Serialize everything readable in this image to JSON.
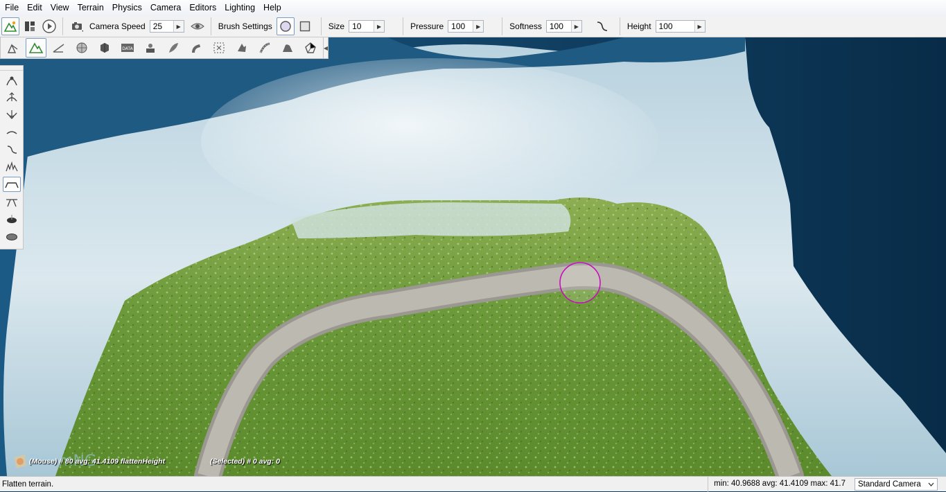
{
  "menu": [
    "File",
    "Edit",
    "View",
    "Terrain",
    "Physics",
    "Camera",
    "Editors",
    "Lighting",
    "Help"
  ],
  "toolbar": {
    "camera_speed_label": "Camera Speed",
    "camera_speed_value": "25",
    "brush_settings_label": "Brush Settings",
    "size_label": "Size",
    "size_value": "10",
    "pressure_label": "Pressure",
    "pressure_value": "100",
    "softness_label": "Softness",
    "softness_value": "100",
    "height_label": "Height",
    "height_value": "100"
  },
  "editor_tools": [
    "object-editor-icon",
    "terrain-editor-icon",
    "terrain-painter-icon",
    "sphere-icon",
    "cube-icon",
    "datablock-icon",
    "shape-icon",
    "forest-icon",
    "river-icon",
    "selection-icon",
    "decal-icon",
    "road-icon",
    "mesh-road-icon",
    "navmesh-icon"
  ],
  "terrain_brushes": [
    "grab-terrain-icon",
    "raise-height-icon",
    "lower-height-icon",
    "smooth-icon",
    "smooth-slope-icon",
    "paint-noise-icon",
    "flatten-icon",
    "set-height-icon",
    "clear-terrain-icon",
    "restore-terrain-icon"
  ],
  "overlay": {
    "mouse_info": "(Mouse) # 80  avg: 41.4109 flattenHeight",
    "selected_info": "(Selected) # 0  avg: 0",
    "logo_text": "BeamNG"
  },
  "status": {
    "message": "Flatten terrain.",
    "stats": "min: 40.9688  avg: 41.4109  max: 41.7",
    "camera_select": "Standard Camera"
  }
}
